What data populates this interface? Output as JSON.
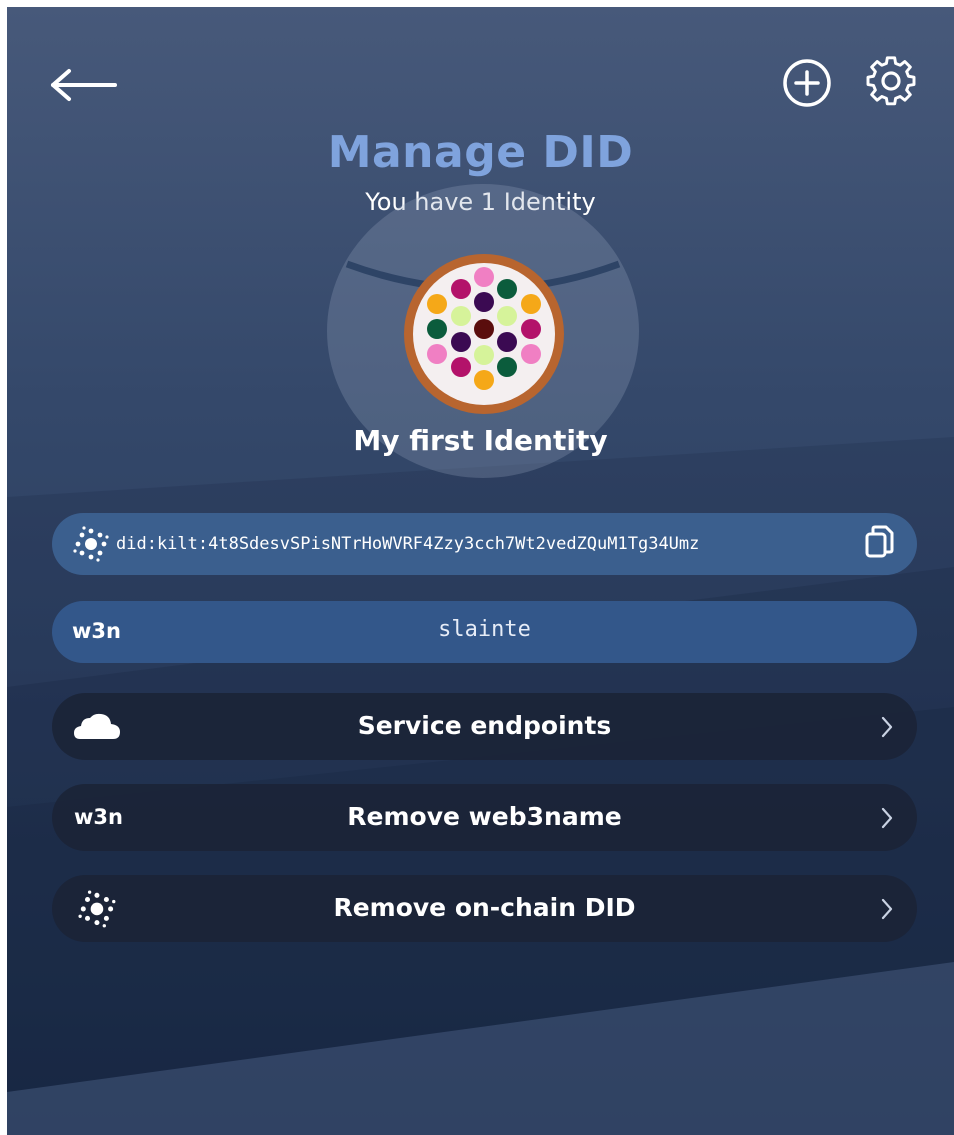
{
  "header": {
    "title": "Manage DID",
    "subtitle": "You have 1 Identity"
  },
  "identity": {
    "name": "My first Identity"
  },
  "did": {
    "value": "did:kilt:4t8SdesvSPisNTrHoWVRF4Zzy3cch7Wt2vedZQuM1Tg34Umz"
  },
  "web3name": {
    "logo": "w3n",
    "value": "slainte"
  },
  "menu": [
    {
      "label": "Service endpoints",
      "icon": "cloud-icon"
    },
    {
      "label": "Remove web3name",
      "icon": "w3n-logo",
      "logo": "w3n"
    },
    {
      "label": "Remove on-chain DID",
      "icon": "did-sun-icon"
    }
  ],
  "colors": {
    "title": "#7fa3dd",
    "did_pill": "#3b5f8e",
    "w3n_pill": "#33578a",
    "menu_row": "#1b2437",
    "avatar_ring": "#b8652f"
  }
}
